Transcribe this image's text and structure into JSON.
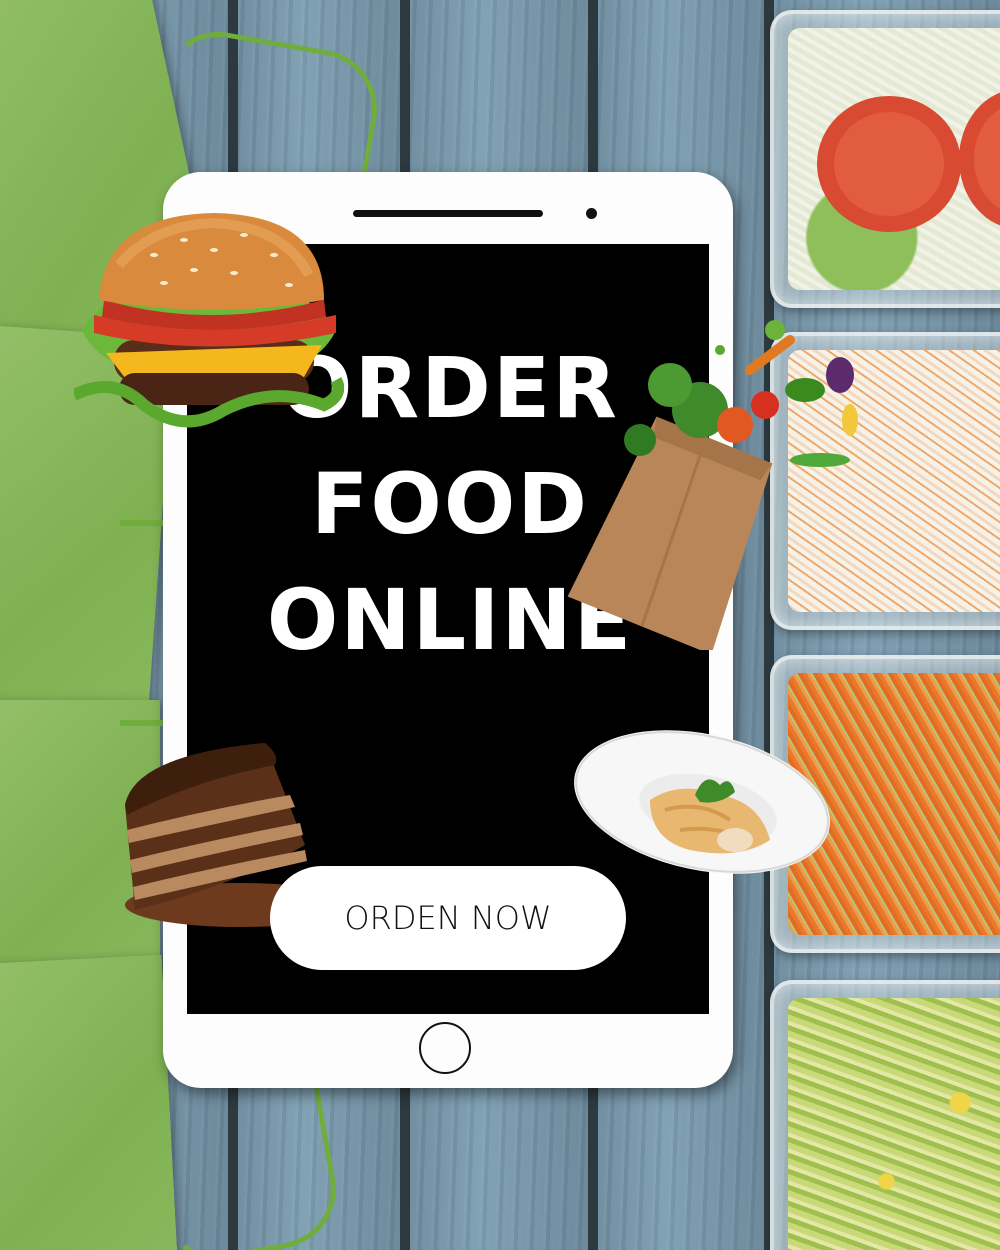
{
  "headline": {
    "line1": "ORDER",
    "line2": "FOOD",
    "line3": "ONLINE"
  },
  "cta": {
    "label": "ORDEN NOW"
  },
  "colors": {
    "screen": "#000000",
    "tablet": "#fdfdfd",
    "bag_green": "#88b95c",
    "wood": "#7fa0b3",
    "cta_background": "#ffffff",
    "cta_text": "#111111",
    "headline_text": "#ffffff"
  },
  "illustrations": [
    "burger",
    "grocery-bag",
    "layer-cake",
    "pasta-plate",
    "green-paper-bags",
    "salad-containers",
    "wood-planks"
  ]
}
